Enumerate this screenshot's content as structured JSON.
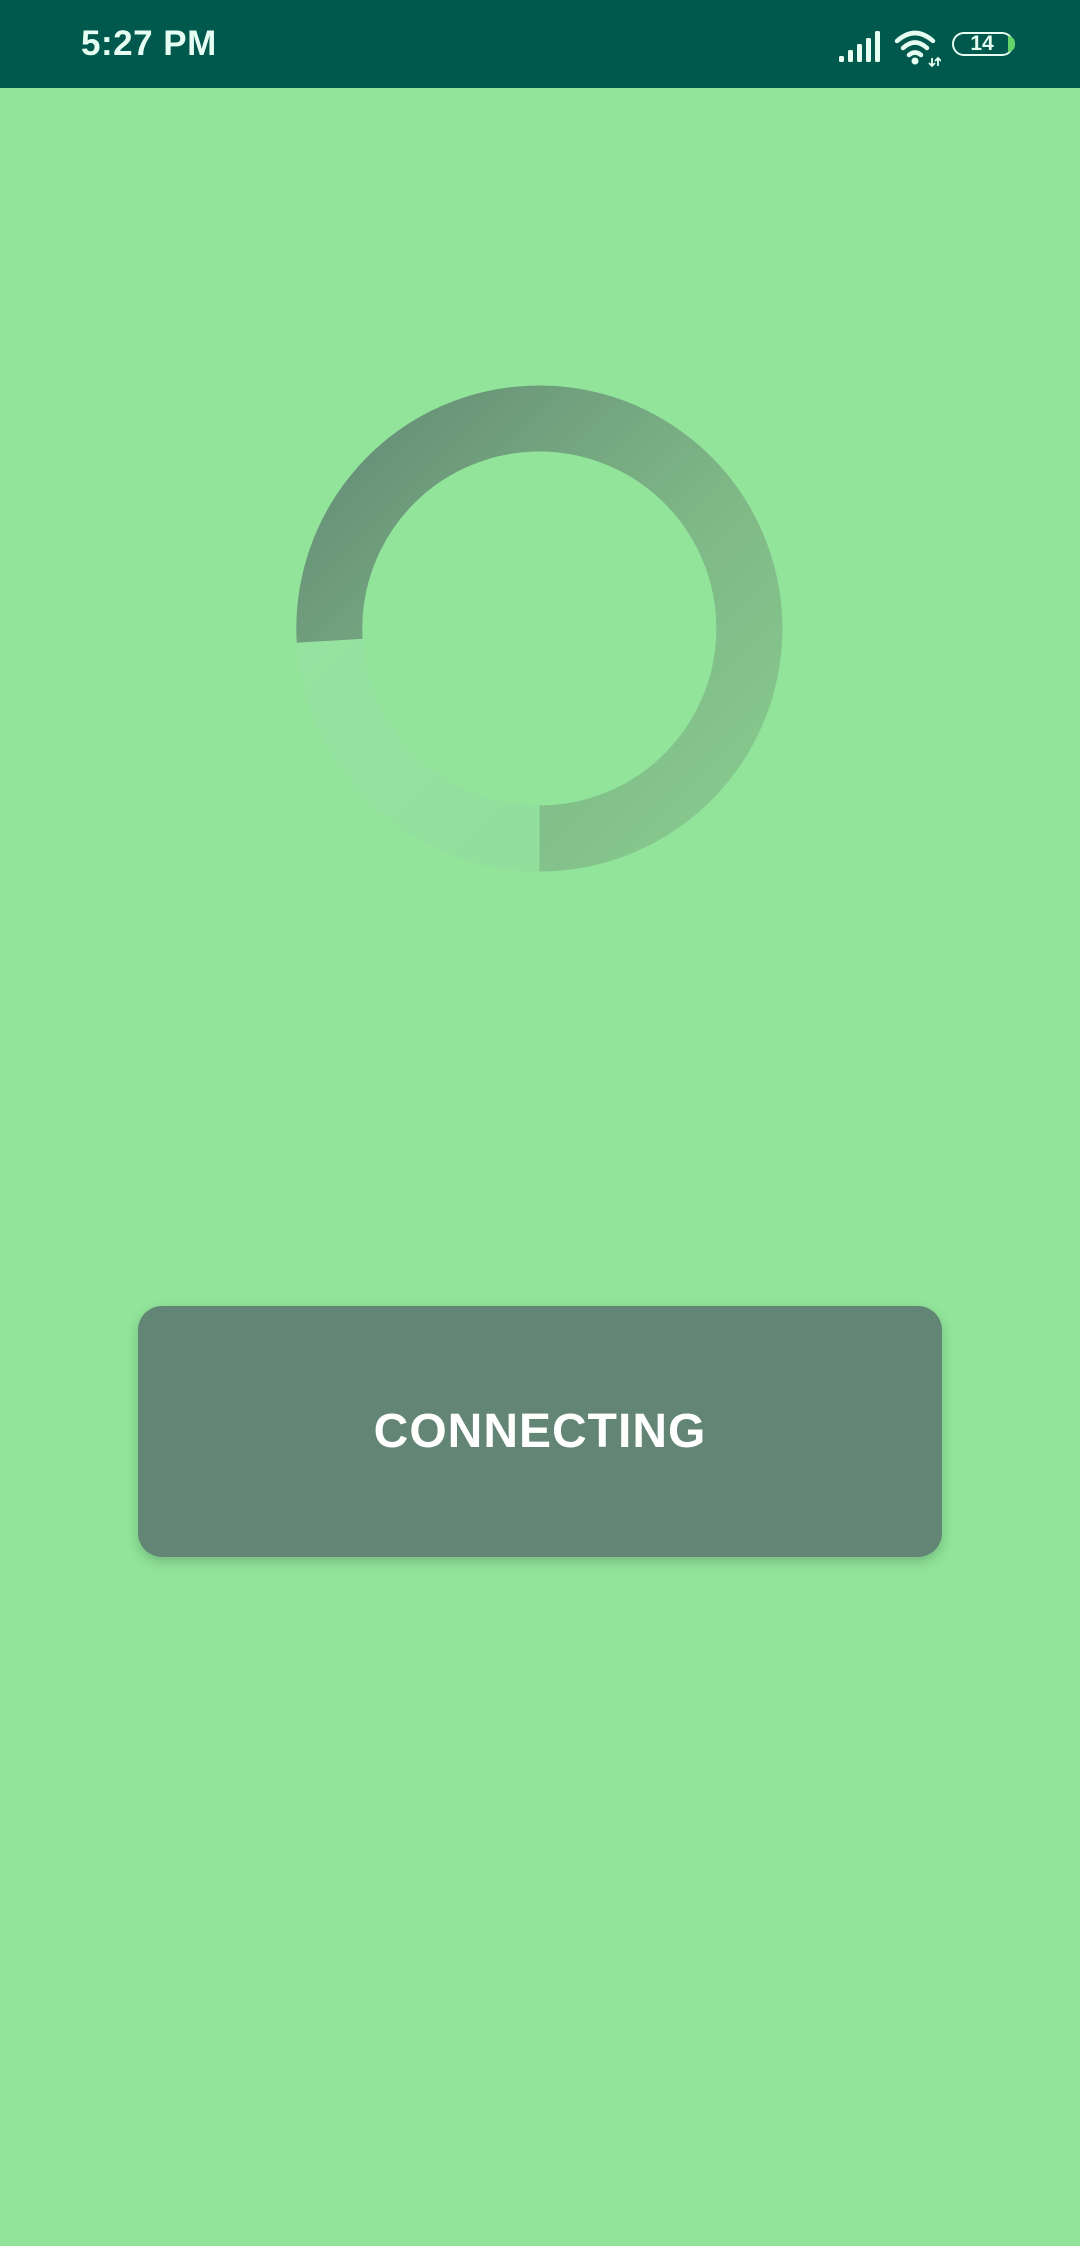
{
  "status_bar": {
    "time": "5:27 PM",
    "battery_level": "14",
    "icons": [
      "signal-icon",
      "wifi-icon",
      "battery-icon"
    ],
    "background_color": "#00594c"
  },
  "loading": {
    "spinner_icon": "circular-progress-spinner"
  },
  "connect_button": {
    "label": "CONNECTING",
    "color": "#638575"
  },
  "theme": {
    "background_color": "#91e49a"
  }
}
